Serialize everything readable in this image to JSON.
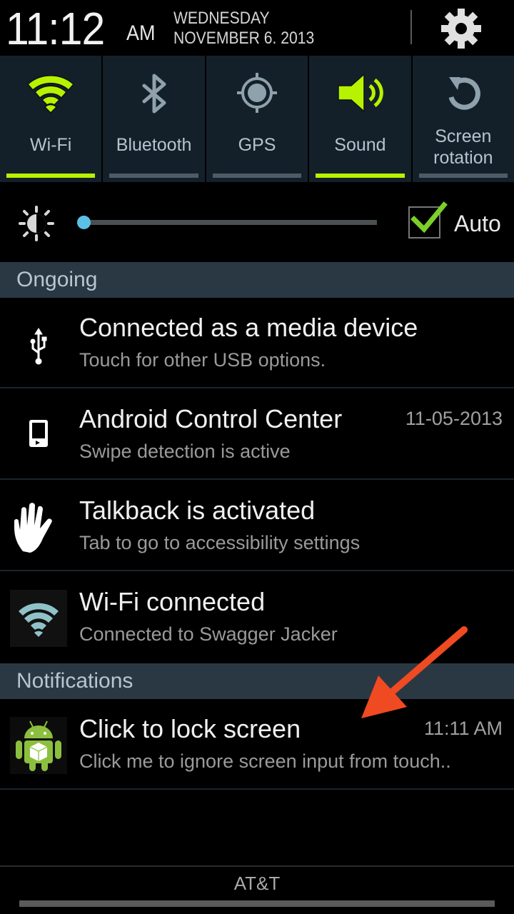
{
  "header": {
    "time": "11:12",
    "ampm": "AM",
    "weekday": "WEDNESDAY",
    "date": "NOVEMBER 6. 2013",
    "settings_icon": "gear-icon"
  },
  "quick_toggles": [
    {
      "label": "Wi-Fi",
      "icon": "wifi-icon",
      "enabled": true
    },
    {
      "label": "Bluetooth",
      "icon": "bluetooth-icon",
      "enabled": false
    },
    {
      "label": "GPS",
      "icon": "gps-icon",
      "enabled": false
    },
    {
      "label": "Sound",
      "icon": "speaker-icon",
      "enabled": true
    },
    {
      "label_line1": "Screen",
      "label_line2": "rotation",
      "icon": "rotation-icon",
      "enabled": false
    }
  ],
  "brightness": {
    "icon": "brightness-icon",
    "level_percent": 0,
    "auto_checked": true,
    "auto_label": "Auto"
  },
  "sections": {
    "ongoing": "Ongoing",
    "notifications": "Notifications"
  },
  "ongoing": [
    {
      "icon": "usb-icon",
      "title": "Connected as a media device",
      "subtitle": "Touch for other USB options.",
      "time": ""
    },
    {
      "icon": "phone-icon",
      "title": "Android Control Center",
      "subtitle": "Swipe detection is active",
      "time": "11-05-2013"
    },
    {
      "icon": "hand-icon",
      "title": "Talkback is activated",
      "subtitle": "Tab to go to accessibility settings",
      "time": ""
    },
    {
      "icon": "wifi-icon",
      "title": "Wi-Fi connected",
      "subtitle": "Connected to Swagger Jacker",
      "time": ""
    }
  ],
  "notifications": [
    {
      "icon": "android-icon",
      "title": "Click to lock screen",
      "subtitle": "Click me to ignore screen input from touch..",
      "time": "11:11 AM"
    }
  ],
  "footer": {
    "carrier": "AT&T"
  },
  "colors": {
    "accent_on": "#b7f200",
    "toggle_bg": "#142029",
    "section_bg": "#2a3843",
    "slider_thumb": "#5bc0e6",
    "annotation_arrow": "#f04a22"
  }
}
